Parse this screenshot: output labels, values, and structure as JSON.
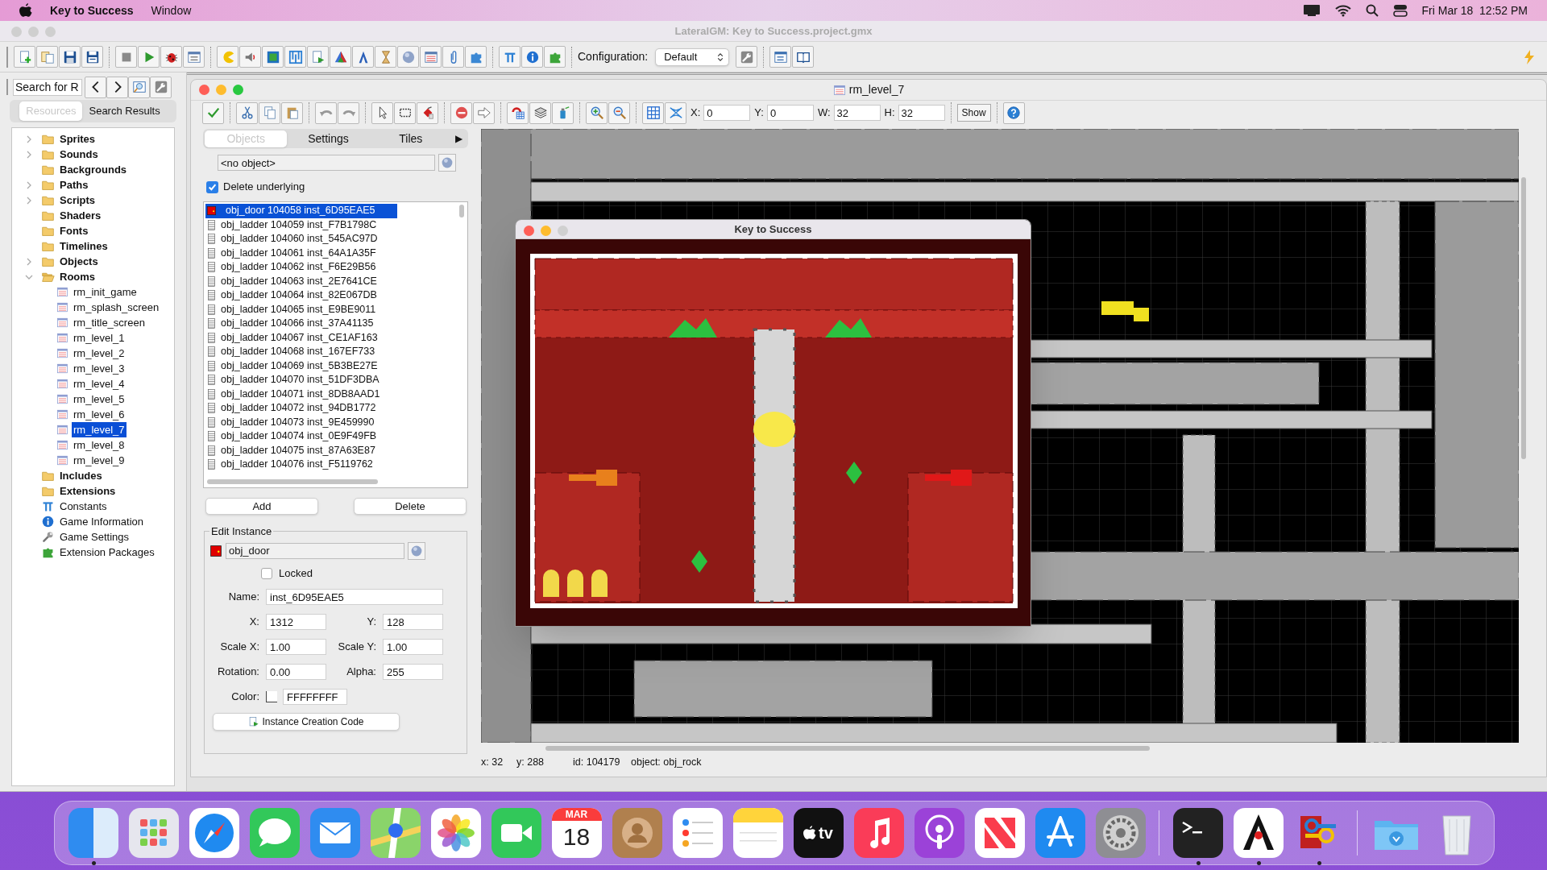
{
  "menubar": {
    "app": "Key to Success",
    "menus": [
      "Window"
    ],
    "clock": "Fri Mar 18  12:52 PM"
  },
  "window": {
    "title": "LateralGM: Key to Success.project.gmx"
  },
  "toolbar": {
    "configuration_label": "Configuration:",
    "configuration": "Default"
  },
  "resources_panel": {
    "search": {
      "value": "Search for R"
    },
    "tabs": [
      {
        "label": "Resources",
        "selected": true
      },
      {
        "label": "Search Results",
        "selected": false
      }
    ],
    "tree": [
      {
        "label": "Sprites",
        "kind": "folder",
        "expanded": false,
        "selected": false
      },
      {
        "label": "Sounds",
        "kind": "folder",
        "expanded": false,
        "selected": false
      },
      {
        "label": "Backgrounds",
        "kind": "folder",
        "selected": false
      },
      {
        "label": "Paths",
        "kind": "folder",
        "expanded": false,
        "selected": false
      },
      {
        "label": "Scripts",
        "kind": "folder",
        "expanded": false,
        "selected": false
      },
      {
        "label": "Shaders",
        "kind": "folder",
        "selected": false
      },
      {
        "label": "Fonts",
        "kind": "folder",
        "selected": false
      },
      {
        "label": "Timelines",
        "kind": "folder",
        "selected": false
      },
      {
        "label": "Objects",
        "kind": "folder",
        "expanded": false,
        "selected": false
      },
      {
        "label": "Rooms",
        "kind": "folder",
        "expanded": true,
        "selected": false,
        "children": [
          {
            "label": "rm_init_game",
            "kind": "room",
            "selected": false
          },
          {
            "label": "rm_splash_screen",
            "kind": "room",
            "selected": false
          },
          {
            "label": "rm_title_screen",
            "kind": "room",
            "selected": false
          },
          {
            "label": "rm_level_1",
            "kind": "room",
            "selected": false
          },
          {
            "label": "rm_level_2",
            "kind": "room",
            "selected": false
          },
          {
            "label": "rm_level_3",
            "kind": "room",
            "selected": false
          },
          {
            "label": "rm_level_4",
            "kind": "room",
            "selected": false
          },
          {
            "label": "rm_level_5",
            "kind": "room",
            "selected": false
          },
          {
            "label": "rm_level_6",
            "kind": "room",
            "selected": false
          },
          {
            "label": "rm_level_7",
            "kind": "room",
            "selected": true
          },
          {
            "label": "rm_level_8",
            "kind": "room",
            "selected": false
          },
          {
            "label": "rm_level_9",
            "kind": "room",
            "selected": false
          }
        ]
      },
      {
        "label": "Includes",
        "kind": "folder",
        "selected": false
      },
      {
        "label": "Extensions",
        "kind": "folder",
        "selected": false
      },
      {
        "label": "Constants",
        "kind": "constants",
        "selected": false
      },
      {
        "label": "Game Information",
        "kind": "info",
        "selected": false
      },
      {
        "label": "Game Settings",
        "kind": "settings",
        "selected": false
      },
      {
        "label": "Extension Packages",
        "kind": "packages",
        "selected": false
      }
    ]
  },
  "room_editor": {
    "title": "rm_level_7",
    "toolbar_fields": [
      {
        "label": "X:",
        "value": "0"
      },
      {
        "label": "Y:",
        "value": "0"
      },
      {
        "label": "W:",
        "value": "32"
      },
      {
        "label": "H:",
        "value": "32"
      }
    ],
    "show_button": "Show",
    "tabs": [
      {
        "label": "Objects",
        "selected": true
      },
      {
        "label": "Settings",
        "selected": false
      },
      {
        "label": "Tiles",
        "selected": false
      }
    ],
    "tab_scroll": "▶",
    "object_picker": "<no object>",
    "delete_underlying": {
      "label": "Delete underlying",
      "checked": true
    },
    "instances": [
      {
        "text": "obj_door 104058 inst_6D95EAE5",
        "kind": "door",
        "selected": true
      },
      {
        "text": "obj_ladder 104059 inst_F7B1798C",
        "kind": "ladder",
        "selected": false
      },
      {
        "text": "obj_ladder 104060 inst_545AC97D",
        "kind": "ladder",
        "selected": false
      },
      {
        "text": "obj_ladder 104061 inst_64A1A35F",
        "kind": "ladder",
        "selected": false
      },
      {
        "text": "obj_ladder 104062 inst_F6E29B56",
        "kind": "ladder",
        "selected": false
      },
      {
        "text": "obj_ladder 104063 inst_2E7641CE",
        "kind": "ladder",
        "selected": false
      },
      {
        "text": "obj_ladder 104064 inst_82E067DB",
        "kind": "ladder",
        "selected": false
      },
      {
        "text": "obj_ladder 104065 inst_E9BE9011",
        "kind": "ladder",
        "selected": false
      },
      {
        "text": "obj_ladder 104066 inst_37A41135",
        "kind": "ladder",
        "selected": false
      },
      {
        "text": "obj_ladder 104067 inst_CE1AF163",
        "kind": "ladder",
        "selected": false
      },
      {
        "text": "obj_ladder 104068 inst_167EF733",
        "kind": "ladder",
        "selected": false
      },
      {
        "text": "obj_ladder 104069 inst_5B3BE27E",
        "kind": "ladder",
        "selected": false
      },
      {
        "text": "obj_ladder 104070 inst_51DF3DBA",
        "kind": "ladder",
        "selected": false
      },
      {
        "text": "obj_ladder 104071 inst_8DB8AAD1",
        "kind": "ladder",
        "selected": false
      },
      {
        "text": "obj_ladder 104072 inst_94DB1772",
        "kind": "ladder",
        "selected": false
      },
      {
        "text": "obj_ladder 104073 inst_9E459990",
        "kind": "ladder",
        "selected": false
      },
      {
        "text": "obj_ladder 104074 inst_0E9F49FB",
        "kind": "ladder",
        "selected": false
      },
      {
        "text": "obj_ladder 104075 inst_87A63E87",
        "kind": "ladder",
        "selected": false
      },
      {
        "text": "obj_ladder 104076 inst_F5119762",
        "kind": "ladder",
        "selected": false
      }
    ],
    "buttons": [
      "Add",
      "Delete"
    ],
    "edit_instance": {
      "title": "Edit Instance",
      "object": "obj_door",
      "locked": {
        "label": "Locked",
        "checked": false
      },
      "rows": [
        [
          {
            "label": "Name:",
            "value": "inst_6D95EAE5"
          }
        ],
        [
          {
            "label": "X:",
            "value": "1312"
          },
          {
            "label": "Y:",
            "value": "128"
          }
        ],
        [
          {
            "label": "Scale X:",
            "value": "1.00"
          },
          {
            "label": "Scale Y:",
            "value": "1.00"
          }
        ],
        [
          {
            "label": "Rotation:",
            "value": "0.00"
          },
          {
            "label": "Alpha:",
            "value": "255"
          }
        ]
      ],
      "color": {
        "label": "Color:",
        "value": "FFFFFFFF"
      },
      "code_button": "Instance Creation Code"
    },
    "status": [
      "x: 32",
      "y: 288",
      "id: 104179",
      "object: obj_rock"
    ]
  },
  "game_window": {
    "title": "Key to Success"
  },
  "dock": [
    {
      "kind": "finder",
      "running": true
    },
    {
      "kind": "launchpad",
      "running": false
    },
    {
      "kind": "safari",
      "running": false
    },
    {
      "kind": "messages",
      "running": false
    },
    {
      "kind": "mail",
      "running": false
    },
    {
      "kind": "maps",
      "running": false
    },
    {
      "kind": "photos",
      "running": false
    },
    {
      "kind": "facetime",
      "running": false
    },
    {
      "kind": "calendar",
      "month": "MAR",
      "day": "18",
      "running": false
    },
    {
      "kind": "contacts",
      "running": false
    },
    {
      "kind": "reminders",
      "running": false
    },
    {
      "kind": "notes",
      "running": false
    },
    {
      "kind": "tv",
      "label": "tv",
      "running": false
    },
    {
      "kind": "music",
      "running": false
    },
    {
      "kind": "podcasts",
      "running": false
    },
    {
      "kind": "news",
      "running": false
    },
    {
      "kind": "appstore",
      "running": false
    },
    {
      "kind": "settings",
      "running": false
    },
    {
      "kind": "separator"
    },
    {
      "kind": "terminal",
      "running": true
    },
    {
      "kind": "mascot",
      "running": true
    },
    {
      "kind": "keys",
      "running": true
    },
    {
      "kind": "separator"
    },
    {
      "kind": "downloads",
      "running": false
    },
    {
      "kind": "trash",
      "running": false
    }
  ]
}
